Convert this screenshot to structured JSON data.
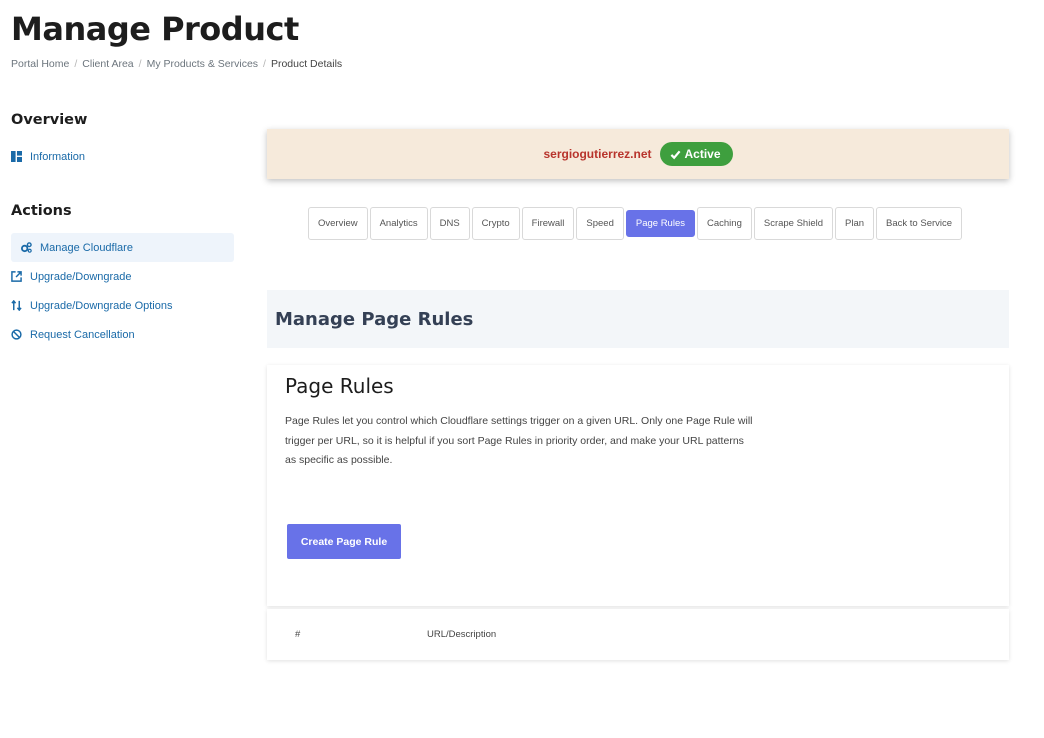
{
  "page": {
    "title": "Manage Product",
    "breadcrumb": [
      "Portal Home",
      "Client Area",
      "My Products & Services",
      "Product Details"
    ]
  },
  "sidebar": {
    "overview_heading": "Overview",
    "overview_items": [
      {
        "label": "Information",
        "icon": "dashboard-icon"
      }
    ],
    "actions_heading": "Actions",
    "action_items": [
      {
        "label": "Manage Cloudflare",
        "icon": "cogs-icon",
        "active": true
      },
      {
        "label": "Upgrade/Downgrade",
        "icon": "external-link-icon"
      },
      {
        "label": "Upgrade/Downgrade Options",
        "icon": "sort-arrows-icon"
      },
      {
        "label": "Request Cancellation",
        "icon": "ban-icon"
      }
    ]
  },
  "status": {
    "domain": "sergiogutierrez.net",
    "badge": "Active",
    "badge_color": "#3e9f3e",
    "domain_color": "#b8342c",
    "banner_color": "#f6eadb"
  },
  "tabs": [
    {
      "label": "Overview"
    },
    {
      "label": "Analytics"
    },
    {
      "label": "DNS"
    },
    {
      "label": "Crypto"
    },
    {
      "label": "Firewall"
    },
    {
      "label": "Speed"
    },
    {
      "label": "Page Rules",
      "active": true
    },
    {
      "label": "Caching"
    },
    {
      "label": "Scrape Shield"
    },
    {
      "label": "Plan"
    },
    {
      "label": "Back to Service"
    }
  ],
  "section": {
    "title": "Manage Page Rules"
  },
  "card": {
    "title": "Page Rules",
    "description": "Page Rules let you control which Cloudflare settings trigger on a given URL. Only one Page Rule will trigger per URL, so it is helpful if you sort Page Rules in priority order, and make your URL patterns as specific as possible.",
    "create_button": "Create Page Rule"
  },
  "table": {
    "headers": [
      "#",
      "URL/Description"
    ]
  },
  "colors": {
    "accent": "#6872e8",
    "link": "#1a6aa8"
  }
}
